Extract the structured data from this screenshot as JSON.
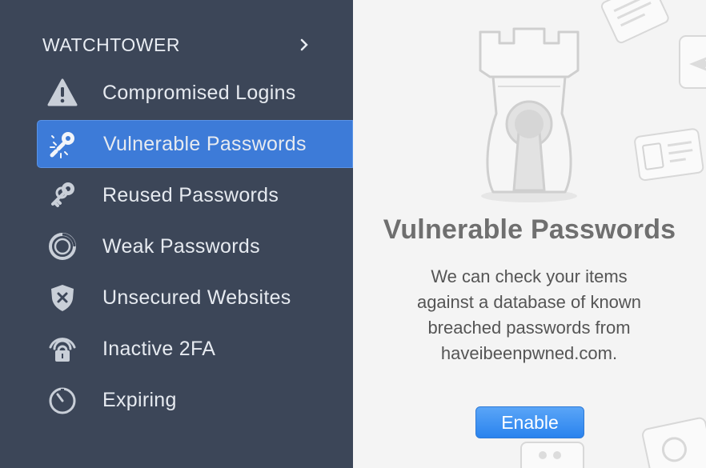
{
  "sidebar": {
    "header": "WATCHTOWER",
    "items": [
      {
        "label": "Compromised Logins",
        "icon": "warning-icon"
      },
      {
        "label": "Vulnerable Passwords",
        "icon": "broken-key-icon",
        "active": true
      },
      {
        "label": "Reused Passwords",
        "icon": "keys-icon"
      },
      {
        "label": "Weak Passwords",
        "icon": "ring-icon"
      },
      {
        "label": "Unsecured Websites",
        "icon": "shield-x-icon"
      },
      {
        "label": "Inactive 2FA",
        "icon": "lock-wifi-icon"
      },
      {
        "label": "Expiring",
        "icon": "clock-icon"
      }
    ]
  },
  "main": {
    "title": "Vulnerable Passwords",
    "description": "We can check your items against a database of known breached passwords from haveibeenpwned.com.",
    "enable_label": "Enable"
  },
  "colors": {
    "sidebar_bg": "#3c4658",
    "active_bg": "#3d7bd8",
    "button_blue": "#2a83ee",
    "title_gray": "#6f6f6f"
  }
}
